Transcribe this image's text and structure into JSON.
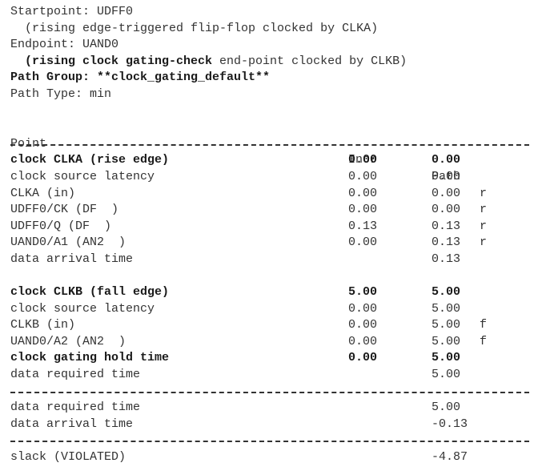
{
  "header": {
    "startpoint": "Startpoint: UDFF0",
    "startpoint_desc": "  (rising edge-triggered flip-flop clocked by CLKA)",
    "endpoint": "Endpoint: UAND0",
    "endpoint_desc_bold": "  (rising clock gating-check",
    "endpoint_desc_rest": " end-point clocked by CLKB)",
    "path_group": "Path Group: **clock_gating_default**",
    "path_type": "Path Type: min"
  },
  "columns": {
    "point": "Point",
    "incr": "Incr",
    "path": "Path"
  },
  "launch_rows": [
    {
      "point": "clock CLKA (rise edge)",
      "incr": "0.00",
      "path": "0.00",
      "flag": "",
      "bold": true
    },
    {
      "point": "clock source latency",
      "incr": "0.00",
      "path": "0.00",
      "flag": "",
      "bold": false
    },
    {
      "point": "CLKA (in)",
      "incr": "0.00",
      "path": "0.00",
      "flag": "r",
      "bold": false
    },
    {
      "point": "UDFF0/CK (DF  )",
      "incr": "0.00",
      "path": "0.00",
      "flag": "r",
      "bold": false
    },
    {
      "point": "UDFF0/Q (DF  )",
      "incr": "0.13",
      "path": "0.13",
      "flag": "r",
      "bold": false
    },
    {
      "point": "UAND0/A1 (AN2  )",
      "incr": "0.00",
      "path": "0.13",
      "flag": "r",
      "bold": false
    },
    {
      "point": "data arrival time",
      "incr": "",
      "path": "0.13",
      "flag": "",
      "bold": false
    }
  ],
  "capture_rows": [
    {
      "point": "clock CLKB (fall edge)",
      "incr": "5.00",
      "path": "5.00",
      "flag": "",
      "bold": true
    },
    {
      "point": "clock source latency",
      "incr": "0.00",
      "path": "5.00",
      "flag": "",
      "bold": false
    },
    {
      "point": "CLKB (in)",
      "incr": "0.00",
      "path": "5.00",
      "flag": "f",
      "bold": false
    },
    {
      "point": "UAND0/A2 (AN2  )",
      "incr": "0.00",
      "path": "5.00",
      "flag": "f",
      "bold": false
    },
    {
      "point": "clock gating hold time",
      "incr": "0.00",
      "path": "5.00",
      "flag": "",
      "bold": true
    },
    {
      "point": "data required time",
      "incr": "",
      "path": "5.00",
      "flag": "",
      "bold": false
    }
  ],
  "summary_rows": [
    {
      "point": "data required time",
      "incr": "",
      "path": "5.00",
      "flag": "",
      "bold": false
    },
    {
      "point": "data arrival time",
      "incr": "",
      "path": "-0.13",
      "flag": "",
      "bold": false
    }
  ],
  "slack_rows": [
    {
      "point": "slack (VIOLATED)",
      "incr": "",
      "path": "-4.87",
      "flag": "",
      "bold": false
    }
  ]
}
